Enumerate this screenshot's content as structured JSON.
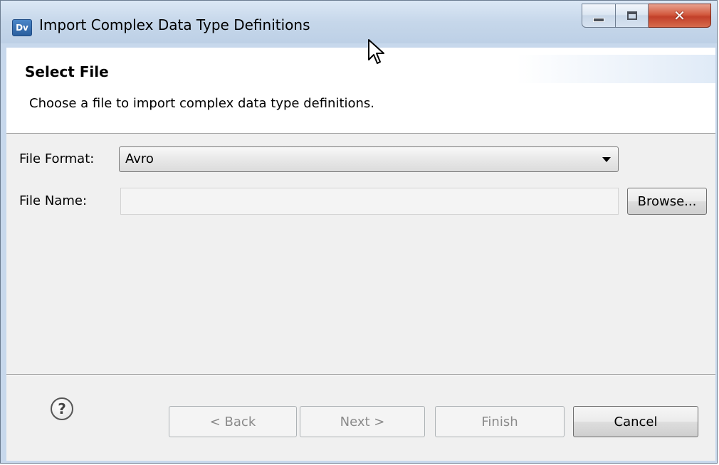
{
  "window": {
    "title": "Import Complex Data Type Definitions",
    "app_icon_text": "Dv"
  },
  "banner": {
    "title": "Select File",
    "description": "Choose a file to import complex data type definitions."
  },
  "form": {
    "file_format_label": "File Format:",
    "file_format_value": "Avro",
    "file_name_label": "File Name:",
    "file_name_value": "",
    "browse_label": "Browse..."
  },
  "footer": {
    "help_icon": "?",
    "back_label": "< Back",
    "next_label": "Next >",
    "finish_label": "Finish",
    "cancel_label": "Cancel"
  }
}
